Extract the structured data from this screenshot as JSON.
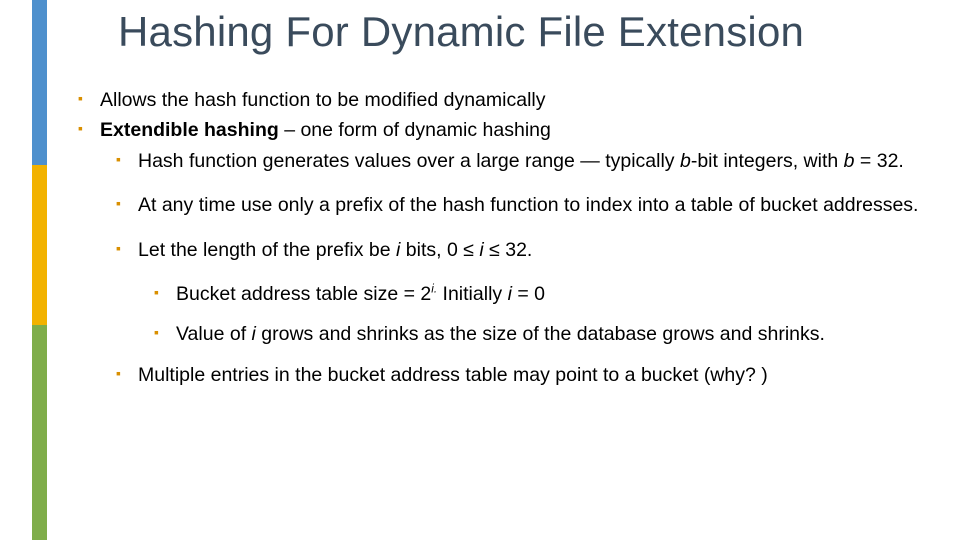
{
  "title": "Hashing For Dynamic File Extension",
  "bullets": {
    "l1a": "Allows the hash function to be modified dynamically",
    "l1b_bold": "Extendible hashing",
    "l1b_rest": " – one form of dynamic hashing",
    "l2a_pre": "Hash function generates values over a large range — typically ",
    "l2a_b": "b",
    "l2a_mid": "-bit integers, with ",
    "l2a_b2": "b",
    "l2a_post": " = 32.",
    "l2b": "At any time use only a prefix of the hash function to index into a table of bucket addresses.",
    "l2c_pre": "Let the length of the prefix be ",
    "l2c_i": "i",
    "l2c_mid": " bits,  0 ",
    "l2c_le1": "≤",
    "l2c_i2": " i ",
    "l2c_le2": "≤",
    "l2c_post": " 32.",
    "l3a_pre": "Bucket address table size = 2",
    "l3a_sup": "i.",
    "l3a_mid": "  Initially ",
    "l3a_i": "i",
    "l3a_post": " = 0",
    "l3b_pre": "Value of ",
    "l3b_i": "i",
    "l3b_post": " grows and shrinks as the size of the database grows and shrinks.",
    "l2d": "Multiple entries in the bucket address table may point to a bucket (why? )"
  }
}
